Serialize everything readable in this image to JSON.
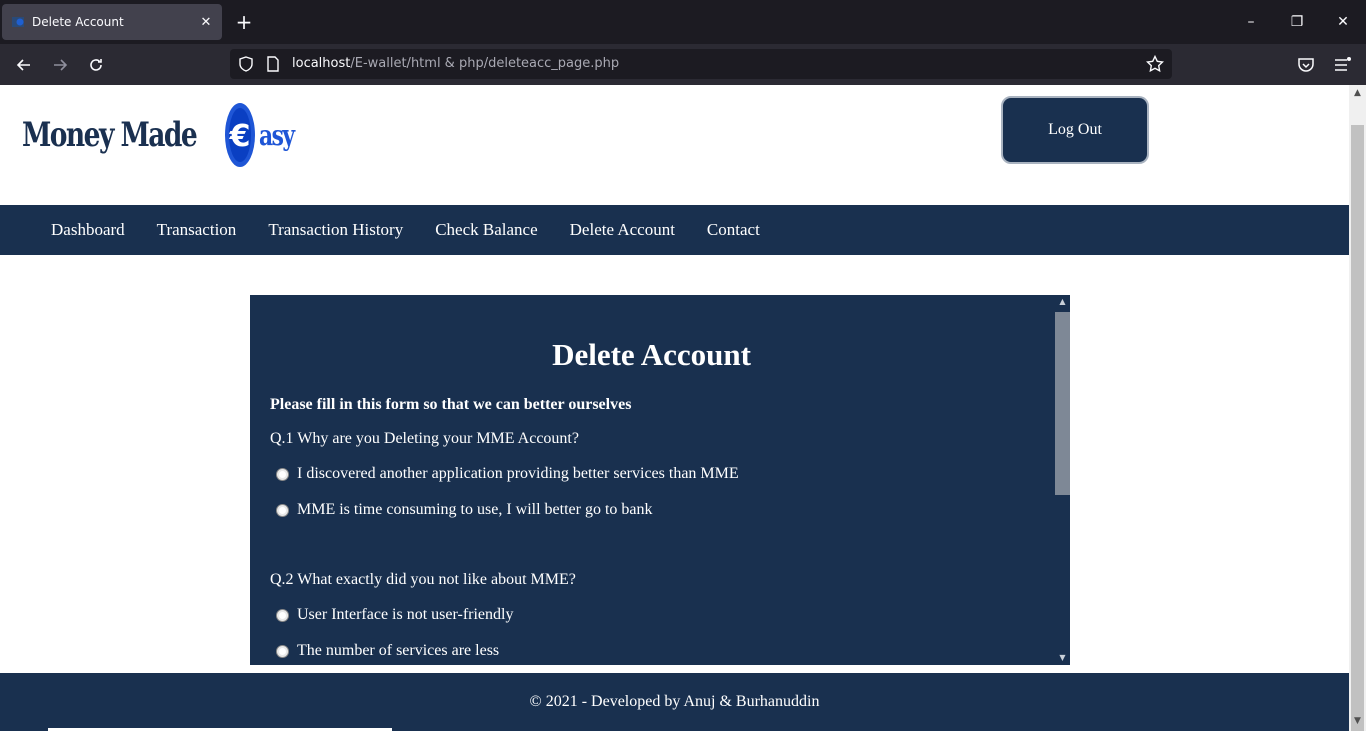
{
  "browser": {
    "tab_title": "Delete Account",
    "url_host": "localhost",
    "url_path": "/E-wallet/html & php/deleteacc_page.php"
  },
  "site": {
    "logo_text": "Money Made",
    "logo_suffix": "asy",
    "logout_label": "Log Out",
    "nav": [
      "Dashboard",
      "Transaction",
      "Transaction History",
      "Check Balance",
      "Delete Account",
      "Contact"
    ]
  },
  "form": {
    "title": "Delete Account",
    "intro": "Please fill in this form so that we can better ourselves",
    "q1": {
      "text": "Q.1 Why are you Deleting your MME Account?",
      "options": [
        "I discovered another application providing better services than MME",
        "MME is time consuming to use, I will better go to bank"
      ]
    },
    "q2": {
      "text": "Q.2 What exactly did you not like about MME?",
      "options": [
        "User Interface is not user-friendly",
        "The number of services are less"
      ]
    }
  },
  "footer": {
    "text": "© 2021 - Developed by Anuj & Burhanuddin"
  },
  "colors": {
    "brand_navy": "#19304f",
    "browser_bg": "#1c1b22"
  }
}
